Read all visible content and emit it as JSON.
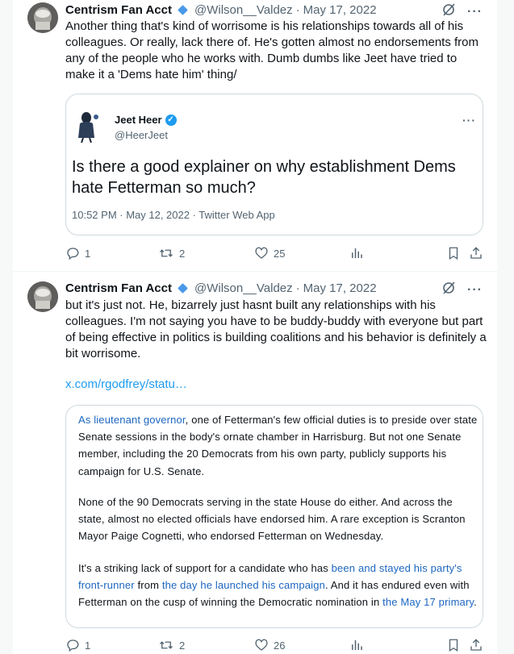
{
  "tweets": [
    {
      "author": "Centrism Fan Acct",
      "handle": "@Wilson__Valdez",
      "separator": "·",
      "date": "May 17, 2022",
      "text": "Another thing that's kind of worrisome is his relationships towards all of his colleagues. Or really, lack there of. He's gotten almost no endorsements from any of the people who he works with. Dumb dumbs like Jeet have tried to make it a 'Dems hate him' thing/",
      "quote": {
        "author": "Jeet Heer",
        "verified_mark": "✓",
        "handle": "@HeerJeet",
        "text": "Is there a good explainer on why establishment Dems hate Fetterman so much?",
        "meta": "10:52 PM · May 12, 2022 · Twitter Web App"
      },
      "actions": {
        "replies": "1",
        "retweets": "2",
        "likes": "25"
      }
    },
    {
      "author": "Centrism Fan Acct",
      "handle": "@Wilson__Valdez",
      "separator": "·",
      "date": "May 17, 2022",
      "text": "but it's just not. He, bizarrely just hasnt built any relationships with his colleagues. I'm not saying you have to be buddy-buddy with everyone but part of being effective in politics is building coalitions and his behavior is definitely a bit worrisome.",
      "link": "x.com/rgodfrey/statu…",
      "article": {
        "p1_link": "As lieutenant governor",
        "p1_rest": ", one of Fetterman's few official duties is to preside over state Senate sessions in the body's ornate chamber in Harrisburg. But not one Senate member, including the 20 Democrats from his own party, publicly supports his campaign for U.S. Senate.",
        "p2": "None of the 90 Democrats serving in the state House do either. And across the state, almost no elected officials have endorsed him. A rare exception is Scranton Mayor Paige Cognetti, who endorsed Fetterman on Wednesday.",
        "p3_a": "It's a striking lack of support for a candidate who has ",
        "p3_link1": "been and stayed his party's front-runner",
        "p3_b": " from ",
        "p3_link2": "the day he launched his campaign",
        "p3_c": ". And it has endured even with Fetterman on the cusp of winning the Democratic nomination in ",
        "p3_link3": "the May 17 primary",
        "p3_d": "."
      },
      "actions": {
        "replies": "1",
        "retweets": "2",
        "likes": "26"
      }
    }
  ],
  "colors": {
    "link": "#1d9bf0",
    "article_link": "#1d66c0",
    "muted": "#536471",
    "border": "#cfd9de"
  }
}
